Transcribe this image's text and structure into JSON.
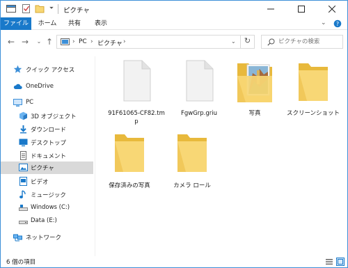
{
  "window": {
    "title": "ピクチャ",
    "controls": [
      "minimize-icon",
      "maximize-icon",
      "close-icon"
    ]
  },
  "ribbon": {
    "tabs": [
      {
        "label": "ファイル"
      },
      {
        "label": "ホーム"
      },
      {
        "label": "共有"
      },
      {
        "label": "表示"
      }
    ]
  },
  "address_bar": {
    "segments": [
      "PC",
      "ピクチャ"
    ],
    "search_placeholder": "ピクチャの検索"
  },
  "sidebar": {
    "items": [
      {
        "label": "クイック アクセス",
        "icon": "star-icon"
      },
      {
        "label": "OneDrive",
        "icon": "cloud-icon"
      },
      {
        "label": "PC",
        "icon": "computer-icon"
      },
      {
        "label": "3D オブジェクト",
        "icon": "cube-icon"
      },
      {
        "label": "ダウンロード",
        "icon": "download-icon"
      },
      {
        "label": "デスクトップ",
        "icon": "desktop-icon"
      },
      {
        "label": "ドキュメント",
        "icon": "document-icon"
      },
      {
        "label": "ピクチャ",
        "icon": "pictures-icon",
        "selected": true
      },
      {
        "label": "ビデオ",
        "icon": "video-icon"
      },
      {
        "label": "ミュージック",
        "icon": "music-icon"
      },
      {
        "label": "Windows (C:)",
        "icon": "drive-icon"
      },
      {
        "label": "Data (E:)",
        "icon": "drive-icon"
      },
      {
        "label": "ネットワーク",
        "icon": "network-icon"
      }
    ]
  },
  "files": [
    {
      "name": "91F61065-CF82.tmp",
      "type": "file"
    },
    {
      "name": "FgwGrp.griu",
      "type": "file"
    },
    {
      "name": "写真",
      "type": "folder-photo"
    },
    {
      "name": "スクリーンショット",
      "type": "folder"
    },
    {
      "name": "保存済みの写真",
      "type": "folder"
    },
    {
      "name": "カメラ ロール",
      "type": "folder"
    }
  ],
  "status": {
    "item_count": "6 個の項目"
  },
  "colors": {
    "accent": "#1979ca",
    "folder": "#f8d775",
    "folder_dark": "#e8b93c",
    "selection": "#d9d9d9"
  }
}
